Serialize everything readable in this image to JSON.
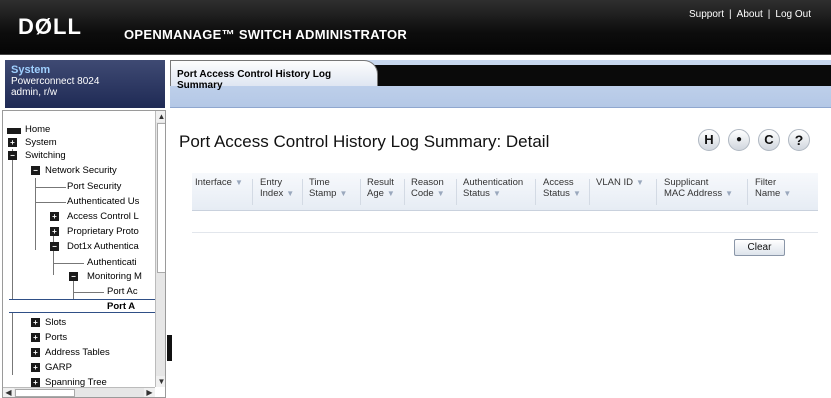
{
  "header": {
    "logo": "DØLL",
    "title": "OPENMANAGE™ SWITCH ADMINISTRATOR",
    "links": [
      "Support",
      "About",
      "Log Out"
    ],
    "separator": "|"
  },
  "system_box": {
    "label": "System",
    "model": "Powerconnect 8024",
    "user": "admin, r/w"
  },
  "tree": {
    "items": [
      {
        "label": "Home"
      },
      {
        "label": "System"
      },
      {
        "label": "Switching"
      },
      {
        "label": "Network Security"
      },
      {
        "label": "Port Security"
      },
      {
        "label": "Authenticated Us"
      },
      {
        "label": "Access Control L"
      },
      {
        "label": "Proprietary Proto"
      },
      {
        "label": "Dot1x Authentica"
      },
      {
        "label": "Authenticati"
      },
      {
        "label": "Monitoring M"
      },
      {
        "label": "Port Ac"
      },
      {
        "label": "Port A"
      },
      {
        "label": "Slots"
      },
      {
        "label": "Ports"
      },
      {
        "label": "Address Tables"
      },
      {
        "label": "GARP"
      },
      {
        "label": "Spanning Tree"
      }
    ]
  },
  "tab": {
    "label": "Port Access Control History Log Summary"
  },
  "content": {
    "title": "Port Access Control History Log Summary: Detail",
    "toolbar": {
      "save": "H",
      "print": "●",
      "refresh": "C",
      "help": "?"
    },
    "columns": [
      {
        "l1": "",
        "l2": "Interface"
      },
      {
        "l1": "Entry",
        "l2": "Index"
      },
      {
        "l1": "Time",
        "l2": "Stamp"
      },
      {
        "l1": "Result",
        "l2": "Age"
      },
      {
        "l1": "Reason",
        "l2": "Code"
      },
      {
        "l1": "Authentication",
        "l2": "Status"
      },
      {
        "l1": "Access",
        "l2": "Status"
      },
      {
        "l1": "",
        "l2": "VLAN ID"
      },
      {
        "l1": "Supplicant",
        "l2": "MAC Address"
      },
      {
        "l1": "Filter",
        "l2": "Name"
      }
    ],
    "clear_label": "Clear"
  },
  "colors": {
    "header_bg": "#0d0d0d",
    "system_box_bg": "#2a3561",
    "tab_bar_bg": "#bcd0ea"
  }
}
